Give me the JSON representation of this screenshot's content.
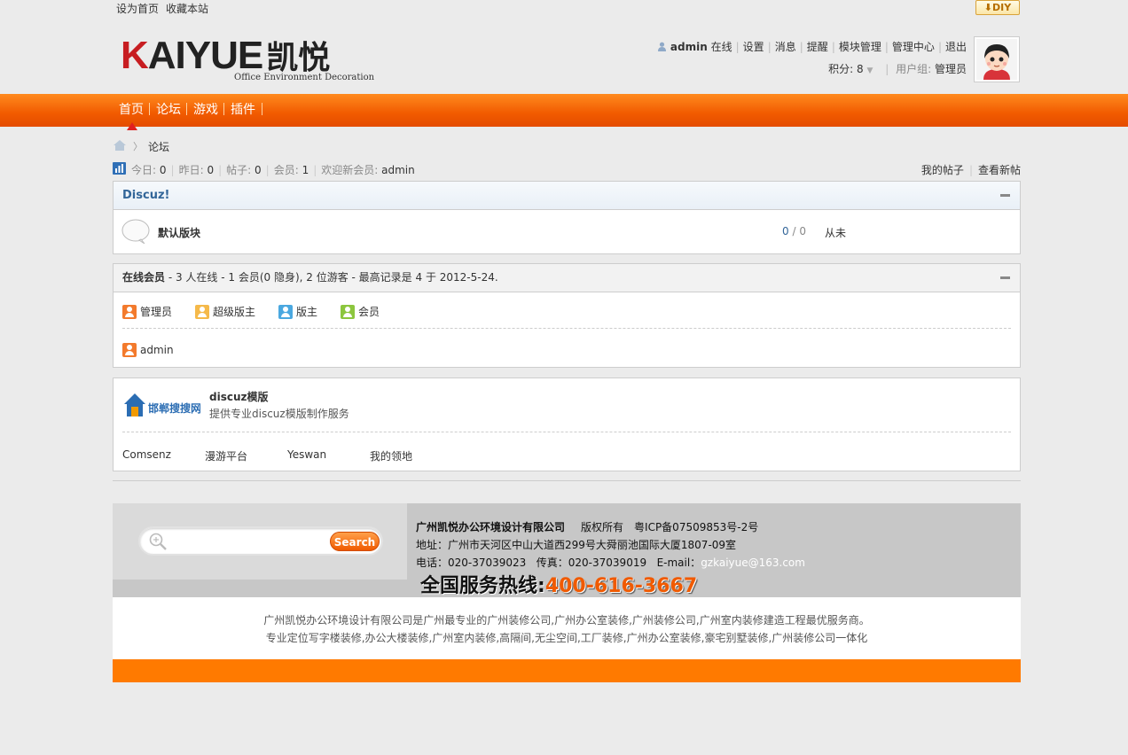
{
  "topbar": {
    "set_home": "设为首页",
    "bookmark": "收藏本站",
    "diy": "DIY"
  },
  "logo": {
    "brand_a": "K",
    "brand_b": "AIYUE",
    "brand_cn": "凯悦",
    "subtitle": "Office Environment Decoration"
  },
  "user": {
    "name": "admin",
    "online": "在线",
    "links": [
      "设置",
      "消息",
      "提醒",
      "模块管理",
      "管理中心",
      "退出"
    ],
    "credits_label": "积分:",
    "credits_value": "8",
    "group_label": "用户组:",
    "group_value": "管理员"
  },
  "nav": {
    "items": [
      "首页",
      "论坛",
      "游戏",
      "插件"
    ]
  },
  "breadcrumb": {
    "current": "论坛"
  },
  "stats": {
    "today_label": "今日:",
    "today": "0",
    "yesterday_label": "昨日:",
    "yesterday": "0",
    "posts_label": "帖子:",
    "posts": "0",
    "members_label": "会员:",
    "members": "1",
    "newest_label": "欢迎新会员:",
    "newest": "admin",
    "my_posts": "我的帖子",
    "new_posts": "查看新帖"
  },
  "forum_category": {
    "title": "Discuz!",
    "forum_name": "默认版块",
    "threads": "0",
    "slash": "/",
    "posts": "0",
    "last_post": "从未"
  },
  "online": {
    "title": "在线会员",
    "summary": " - 3 人在线 - 1 会员(0 隐身), 2 位游客 - 最高记录是 4 于 2012-5-24.",
    "legend": [
      "管理员",
      "超级版主",
      "版主",
      "会员"
    ],
    "user": "admin"
  },
  "links": {
    "logo_text": "邯郸搜搜网",
    "title": "discuz模版",
    "desc": "提供专业discuz模版制作服务",
    "text_links": [
      "Comsenz",
      "漫游平台",
      "Yeswan",
      "我的领地"
    ]
  },
  "footer": {
    "search_button": "Search",
    "company": "广州凯悦办公环境设计有限公司",
    "copyright": "版权所有",
    "icp": "粤ICP备07509853号-2号",
    "address": "地址：广州市天河区中山大道西299号大舜丽池国际大厦1807-09室",
    "phone": "电话：020-37039023",
    "fax": "传真：020-37039019",
    "email_label": "E-mail：",
    "email": "gzkaiyue@163.com",
    "hotline_label": "全国服务热线:",
    "hotline": "400-616-3667",
    "desc1": "广州凯悦办公环境设计有限公司是广州最专业的广州装修公司,广州办公室装修,广州装修公司,广州室内装修建造工程最优服务商。",
    "desc2": "专业定位写字楼装修,办公大楼装修,广州室内装修,高隔间,无尘空间,工厂装修,广州办公室装修,豪宅别墅装修,广州装修公司一体化"
  },
  "colors": {
    "accent": "#f15a00",
    "link": "#336699",
    "footer_orange": "#ff7a00"
  }
}
